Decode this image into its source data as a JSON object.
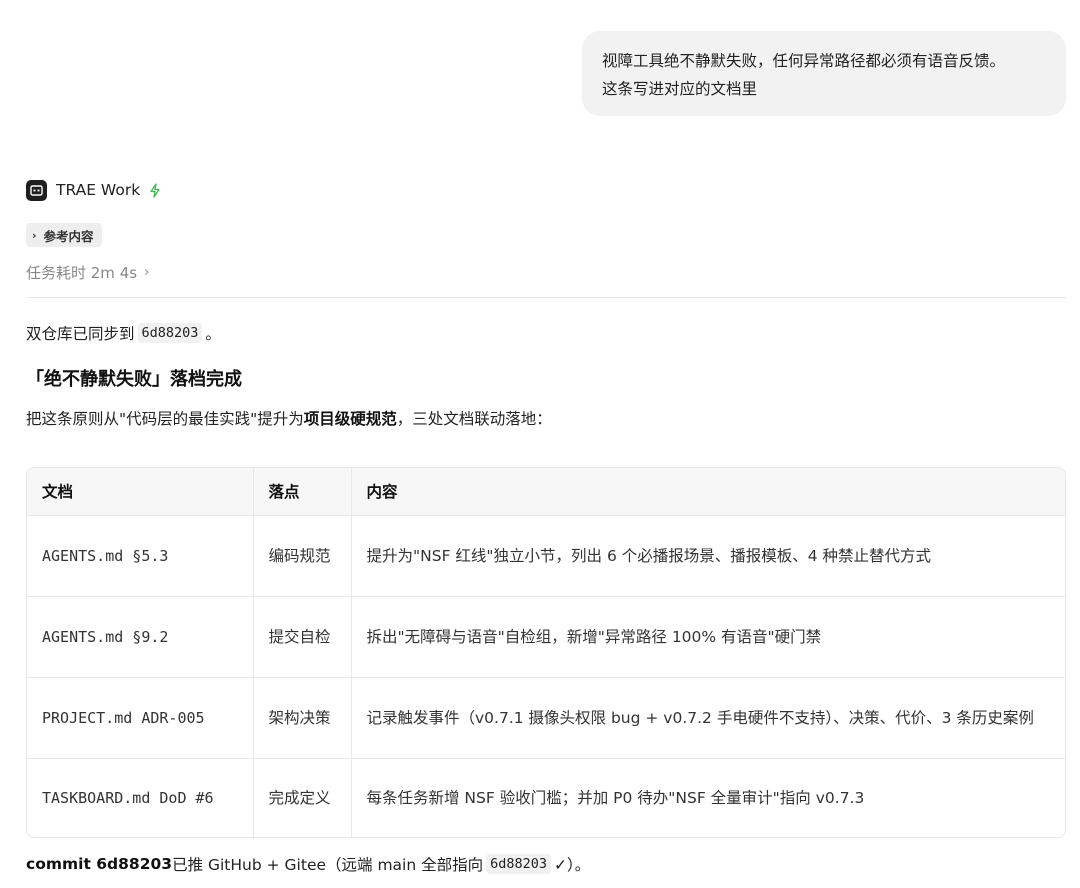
{
  "user_message": {
    "line1": "视障工具绝不静默失败，任何异常路径都必须有语音反馈。",
    "line2": "这条写进对应的文档里"
  },
  "agent": {
    "name": "TRAE Work",
    "logo_icon": "terminal-badge-icon",
    "status_icon": "lightning-bolt-icon",
    "accent_color": "#3fb950"
  },
  "reference_chip": {
    "label": "参考内容"
  },
  "task_duration": {
    "label": "任务耗时 2m 4s"
  },
  "sync": {
    "prefix": "双仓库已同步到",
    "commit": "6d88203",
    "suffix": "。"
  },
  "section": {
    "title": "「绝不静默失败」落档完成"
  },
  "intro": {
    "before": "把这条原则从\"代码层的最佳实践\"提升为",
    "bold": "项目级硬规范",
    "after": "，三处文档联动落地："
  },
  "table": {
    "headers": [
      "文档",
      "落点",
      "内容"
    ],
    "rows": [
      {
        "doc": "AGENTS.md §5.3",
        "point": "编码规范",
        "content": "提升为\"NSF 红线\"独立小节，列出 6 个必播报场景、播报模板、4 种禁止替代方式"
      },
      {
        "doc": "AGENTS.md §9.2",
        "point": "提交自检",
        "content": "拆出\"无障碍与语音\"自检组，新增\"异常路径 100% 有语音\"硬门禁"
      },
      {
        "doc": "PROJECT.md ADR-005",
        "point": "架构决策",
        "content": "记录触发事件（v0.7.1 摄像头权限 bug + v0.7.2 手电硬件不支持）、决策、代价、3 条历史案例"
      },
      {
        "doc": "TASKBOARD.md DoD #6",
        "point": "完成定义",
        "content": "每条任务新增 NSF 验收门槛；并加 P0 待办\"NSF 全量审计\"指向 v0.7.3"
      }
    ]
  },
  "commit_line": {
    "bold": "commit 6d88203",
    "middle": " 已推 GitHub + Gitee（远端 main 全部指向",
    "code": "6d88203",
    "suffix": "✓）。"
  }
}
